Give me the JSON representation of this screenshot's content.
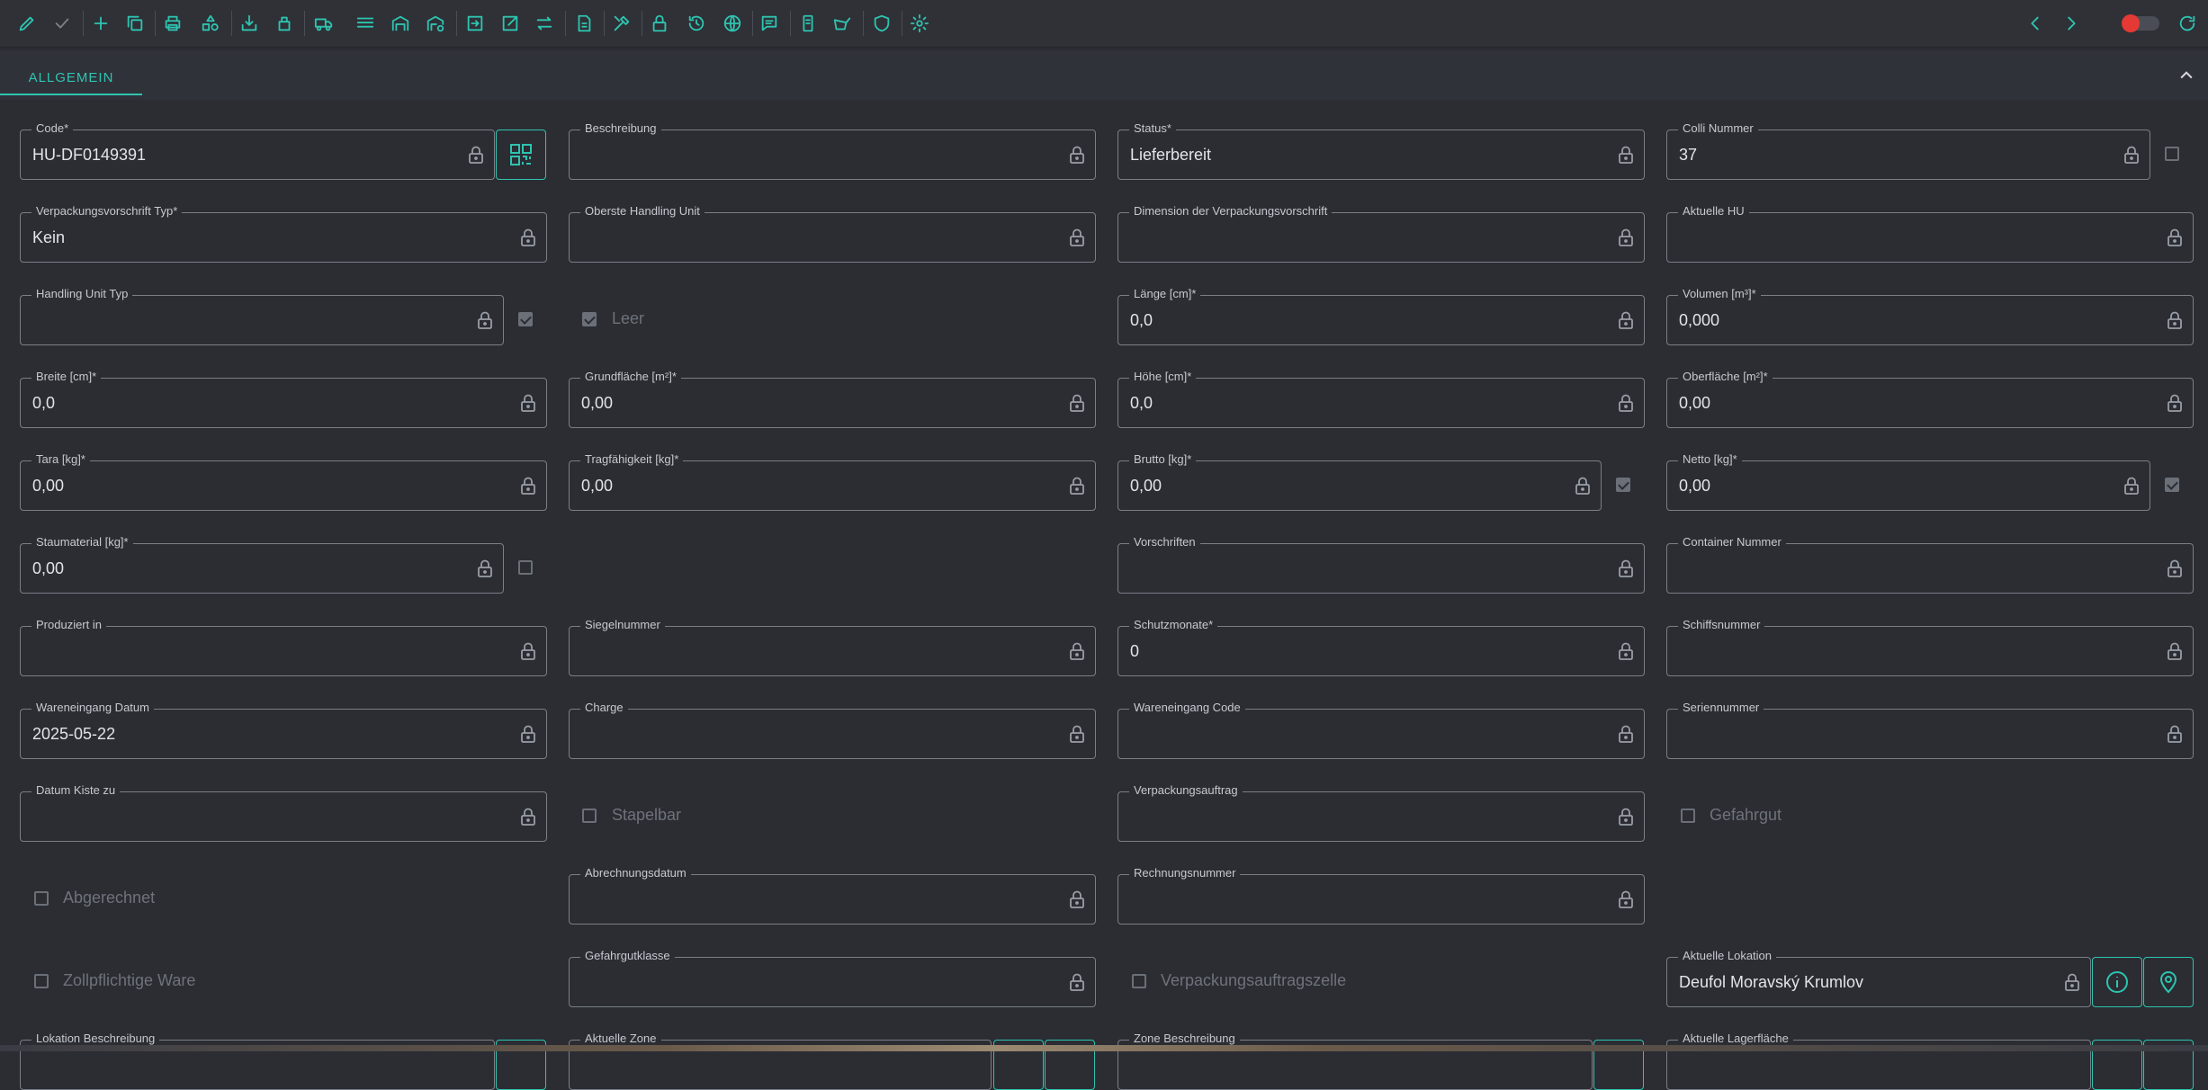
{
  "toolbar": {
    "icons": [
      "edit-icon",
      "check-icon",
      "add-icon",
      "copy-icon",
      "print-icon",
      "shapes-icon",
      "download-box-icon",
      "box-stack-icon",
      "truck-icon",
      "layers-icon",
      "warehouse-icon",
      "warehouse-gear-icon",
      "arrow-in-icon",
      "arrow-out-icon",
      "swap-icon",
      "document-icon",
      "tools-icon",
      "lock-icon",
      "history-icon",
      "globe-icon",
      "comment-icon",
      "mobile-icon",
      "scanner-icon",
      "shield-icon",
      "gear-icon"
    ],
    "accent": "#2ec4b0",
    "toggle_color": "#e53935"
  },
  "tabs": {
    "general": "ALLGEMEIN"
  },
  "fields": {
    "code": {
      "label": "Code*",
      "value": "HU-DF0149391"
    },
    "beschreibung": {
      "label": "Beschreibung",
      "value": ""
    },
    "status": {
      "label": "Status*",
      "value": "Lieferbereit"
    },
    "colli": {
      "label": "Colli Nummer",
      "value": "37"
    },
    "verpackungsvorschrift_typ": {
      "label": "Verpackungsvorschrift Typ*",
      "value": "Kein"
    },
    "oberste_hu": {
      "label": "Oberste Handling Unit",
      "value": ""
    },
    "dimension": {
      "label": "Dimension der Verpackungsvorschrift",
      "value": ""
    },
    "aktuelle_hu": {
      "label": "Aktuelle HU",
      "value": ""
    },
    "hu_typ": {
      "label": "Handling Unit Typ",
      "value": ""
    },
    "laenge": {
      "label": "Länge [cm]*",
      "value": "0,0"
    },
    "volumen": {
      "label": "Volumen [m³]*",
      "value": "0,000"
    },
    "breite": {
      "label": "Breite [cm]*",
      "value": "0,0"
    },
    "grundflaeche": {
      "label": "Grundfläche [m²]*",
      "value": "0,00"
    },
    "hoehe": {
      "label": "Höhe [cm]*",
      "value": "0,0"
    },
    "oberflaeche": {
      "label": "Oberfläche [m²]*",
      "value": "0,00"
    },
    "tara": {
      "label": "Tara [kg]*",
      "value": "0,00"
    },
    "tragfaehigkeit": {
      "label": "Tragfähigkeit [kg]*",
      "value": "0,00"
    },
    "brutto": {
      "label": "Brutto [kg]*",
      "value": "0,00"
    },
    "netto": {
      "label": "Netto [kg]*",
      "value": "0,00"
    },
    "staumaterial": {
      "label": "Staumaterial [kg]*",
      "value": "0,00"
    },
    "vorschriften": {
      "label": "Vorschriften",
      "value": ""
    },
    "container": {
      "label": "Container Nummer",
      "value": ""
    },
    "produziert": {
      "label": "Produziert in",
      "value": ""
    },
    "siegel": {
      "label": "Siegelnummer",
      "value": ""
    },
    "schutzmonate": {
      "label": "Schutzmonate*",
      "value": "0"
    },
    "schiff": {
      "label": "Schiffsnummer",
      "value": ""
    },
    "we_datum": {
      "label": "Wareneingang Datum",
      "value": "2025-05-22"
    },
    "charge": {
      "label": "Charge",
      "value": ""
    },
    "we_code": {
      "label": "Wareneingang Code",
      "value": ""
    },
    "serien": {
      "label": "Seriennummer",
      "value": ""
    },
    "datum_kiste": {
      "label": "Datum Kiste zu",
      "value": ""
    },
    "verpackungsauftrag": {
      "label": "Verpackungsauftrag",
      "value": ""
    },
    "abrechnungsdatum": {
      "label": "Abrechnungsdatum",
      "value": ""
    },
    "rechnungsnummer": {
      "label": "Rechnungsnummer",
      "value": ""
    },
    "gefahrgutklasse": {
      "label": "Gefahrgutklasse",
      "value": ""
    },
    "aktuelle_lokation": {
      "label": "Aktuelle Lokation",
      "value": "Deufol Moravský Krumlov"
    },
    "lokation_beschreibung": {
      "label": "Lokation Beschreibung",
      "value": ""
    },
    "aktuelle_zone": {
      "label": "Aktuelle Zone",
      "value": ""
    },
    "zone_beschreibung": {
      "label": "Zone Beschreibung",
      "value": ""
    },
    "aktuelle_lagerflaeche": {
      "label": "Aktuelle Lagerfläche",
      "value": ""
    }
  },
  "checkboxes": {
    "leer": {
      "label": "Leer",
      "checked": true
    },
    "stapelbar": {
      "label": "Stapelbar",
      "checked": false
    },
    "gefahrgut": {
      "label": "Gefahrgut",
      "checked": false
    },
    "abgerechnet": {
      "label": "Abgerechnet",
      "checked": false
    },
    "zollpflichtig": {
      "label": "Zollpflichtige Ware",
      "checked": false
    },
    "verpackungsauftragszelle": {
      "label": "Verpackungsauftragszelle",
      "checked": false
    }
  }
}
